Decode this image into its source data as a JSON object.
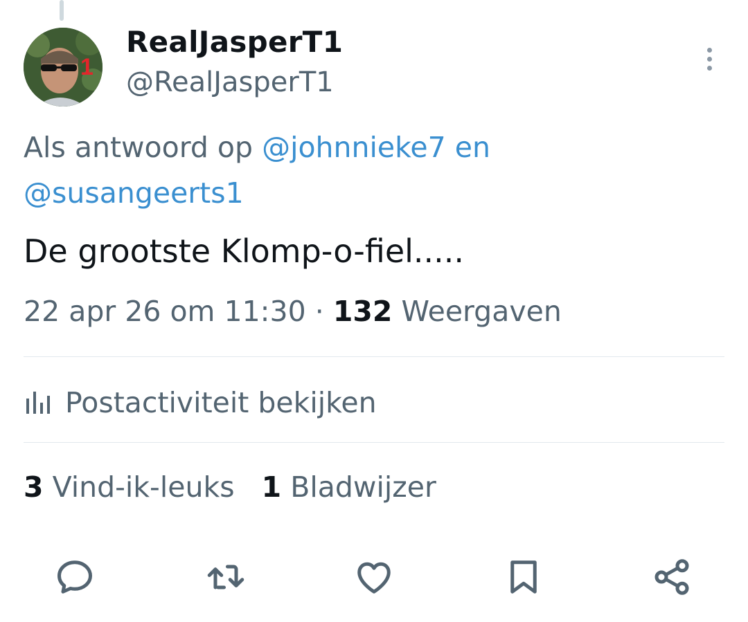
{
  "tweet": {
    "author": {
      "display_name": "RealJasperT1",
      "handle": "@RealJasperT1",
      "avatar_badge": "1"
    },
    "reply_context": {
      "prefix": "Als antwoord op ",
      "mention1": "@johnnieke7",
      "connector": " en",
      "mention2": "@susangeerts1"
    },
    "text": "De grootste Klomp-o-fiel.....",
    "timestamp": "22 apr 26 om 11:30",
    "separator": "·",
    "views_count": "132",
    "views_label": "Weergaven",
    "activity_label": "Postactiviteit bekijken",
    "likes_count": "3",
    "likes_label": "Vind-ik-leuks",
    "bookmarks_count": "1",
    "bookmarks_label": "Bladwijzer"
  },
  "actions": [
    {
      "name": "reply",
      "icon": "reply-icon"
    },
    {
      "name": "repost",
      "icon": "repost-icon"
    },
    {
      "name": "like",
      "icon": "heart-icon"
    },
    {
      "name": "bookmark",
      "icon": "bookmark-icon"
    },
    {
      "name": "share",
      "icon": "share-icon"
    }
  ],
  "colors": {
    "text_primary": "#0f1419",
    "text_secondary": "#536471",
    "mention": "#3a8fd0",
    "divider": "#e1e8ed"
  }
}
